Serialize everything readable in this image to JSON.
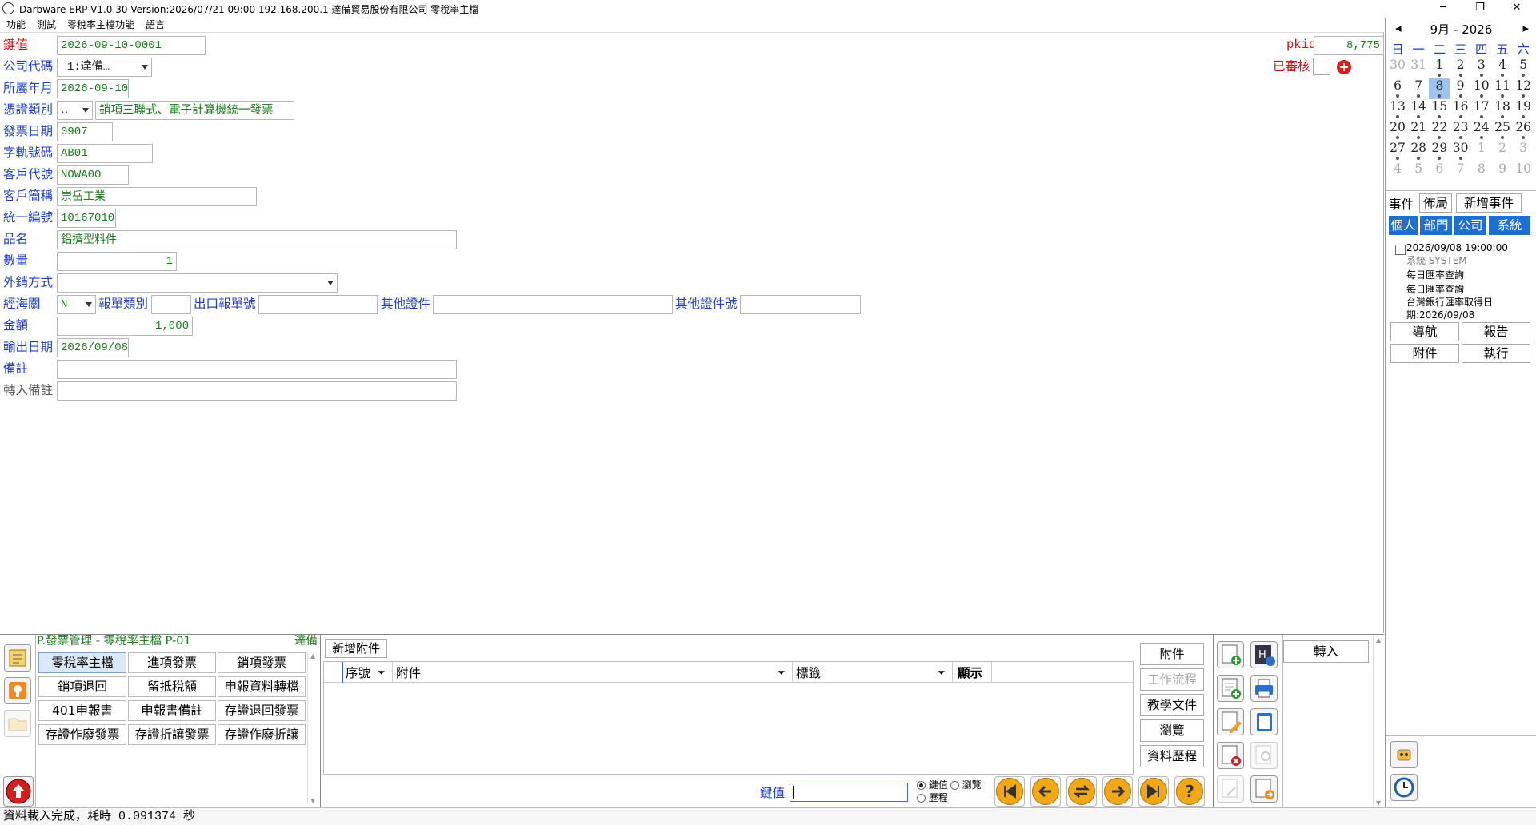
{
  "titlebar": {
    "title": "Darbware ERP V1.0.30 Version:2026/07/21 09:00   192.168.200.1 達備貿易股份有限公司 零稅率主檔",
    "minimize": "─",
    "restore": "❐",
    "close": "✕"
  },
  "menu": [
    "功能",
    "測試",
    "零稅率主檔功能",
    "語言"
  ],
  "form": {
    "key_label": "鍵值",
    "key_value": "2026-09-10-0001",
    "company_label": "公司代碼",
    "company_value": "1:達備…",
    "period_label": "所屬年月",
    "period_value": "2026-09-10",
    "voucher_label": "憑證類別",
    "voucher_code": "‥",
    "voucher_name": "銷項三聯式、電子計算機統一發票",
    "invoice_date_label": "發票日期",
    "invoice_date_value": "0907",
    "track_label": "字軌號碼",
    "track_value": "AB01",
    "cust_code_label": "客戶代號",
    "cust_code_value": "NOWA00",
    "cust_name_label": "客戶簡稱",
    "cust_name_value": "崇岳工業",
    "taxid_label": "統一編號",
    "taxid_value": "10167010",
    "product_label": "品名",
    "product_value": "鋁擠型料件",
    "qty_label": "數量",
    "qty_value": "1",
    "export_label": "外銷方式",
    "export_value": "",
    "customs_label": "經海關",
    "customs_value": "N",
    "decl_type_label": "報單類別",
    "decl_type_value": "",
    "export_no_label": "出口報單號",
    "export_no_value": "",
    "other_doc_label": "其他證件",
    "other_doc_value": "",
    "other_doc_no_label": "其他證件號",
    "other_doc_no_value": "",
    "amount_label": "金額",
    "amount_value": "1,000",
    "out_date_label": "輸出日期",
    "out_date_value": "2026/09/08",
    "remark_label": "備註",
    "remark_value": "",
    "import_remark_label": "轉入備註",
    "import_remark_value": "",
    "pkid_label": "pkid",
    "pkid_value": "8,775",
    "audited_label": "已審核"
  },
  "calendar": {
    "month": "9月",
    "sep": "-",
    "year": "2026",
    "prev": "◂",
    "next": "▸",
    "weekdays": [
      "日",
      "一",
      "二",
      "三",
      "四",
      "五",
      "六"
    ],
    "weeks": [
      [
        "30",
        "31",
        "1",
        "2",
        "3",
        "4",
        "5"
      ],
      [
        "6",
        "7",
        "8",
        "9",
        "10",
        "11",
        "12"
      ],
      [
        "13",
        "14",
        "15",
        "16",
        "17",
        "18",
        "19"
      ],
      [
        "20",
        "21",
        "22",
        "23",
        "24",
        "25",
        "26"
      ],
      [
        "27",
        "28",
        "29",
        "30",
        "1",
        "2",
        "3"
      ],
      [
        "4",
        "5",
        "6",
        "7",
        "8",
        "9",
        "10"
      ]
    ],
    "selected": "8"
  },
  "events": {
    "tab_events": "事件",
    "tab_layout": "佈局",
    "tab_new": "新增事件",
    "scopes": [
      "個人",
      "部門",
      "公司",
      "系統"
    ],
    "item_time": "2026/09/08 19:00:00",
    "item_source": "系統  SYSTEM",
    "item_line1": "每日匯率查詢",
    "item_line2": "每日匯率查詢",
    "item_line3": "台灣銀行匯率取得日",
    "item_line4": "期:2026/09/08",
    "btn_nav": "導航",
    "btn_report": "報告",
    "btn_attach": "附件",
    "btn_exec": "執行"
  },
  "module": {
    "title": "P.發票管理 - 零稅率主檔  P-01",
    "company_tag": "達備",
    "buttons": [
      "零稅率主檔",
      "進項發票",
      "銷項發票",
      "銷項退回",
      "留抵稅額",
      "申報資料轉檔",
      "401申報書",
      "申報書備註",
      "存證退回發票",
      "存證作廢發票",
      "存證折讓發票",
      "存證作廢折讓"
    ]
  },
  "attach": {
    "add_label": "新增附件",
    "col_seq": "序號",
    "col_attach": "附件",
    "col_tag": "標籤",
    "col_show": "顯示",
    "side_buttons": [
      "附件",
      "工作流程",
      "教學文件",
      "瀏覽",
      "資料歷程"
    ],
    "key_label": "鍵值",
    "key_value": "",
    "radio_key": "鍵值",
    "radio_browse": "瀏覽",
    "radio_history": "歷程"
  },
  "import_button": "轉入",
  "status": "資料載入完成，耗時 0.091374 秒"
}
